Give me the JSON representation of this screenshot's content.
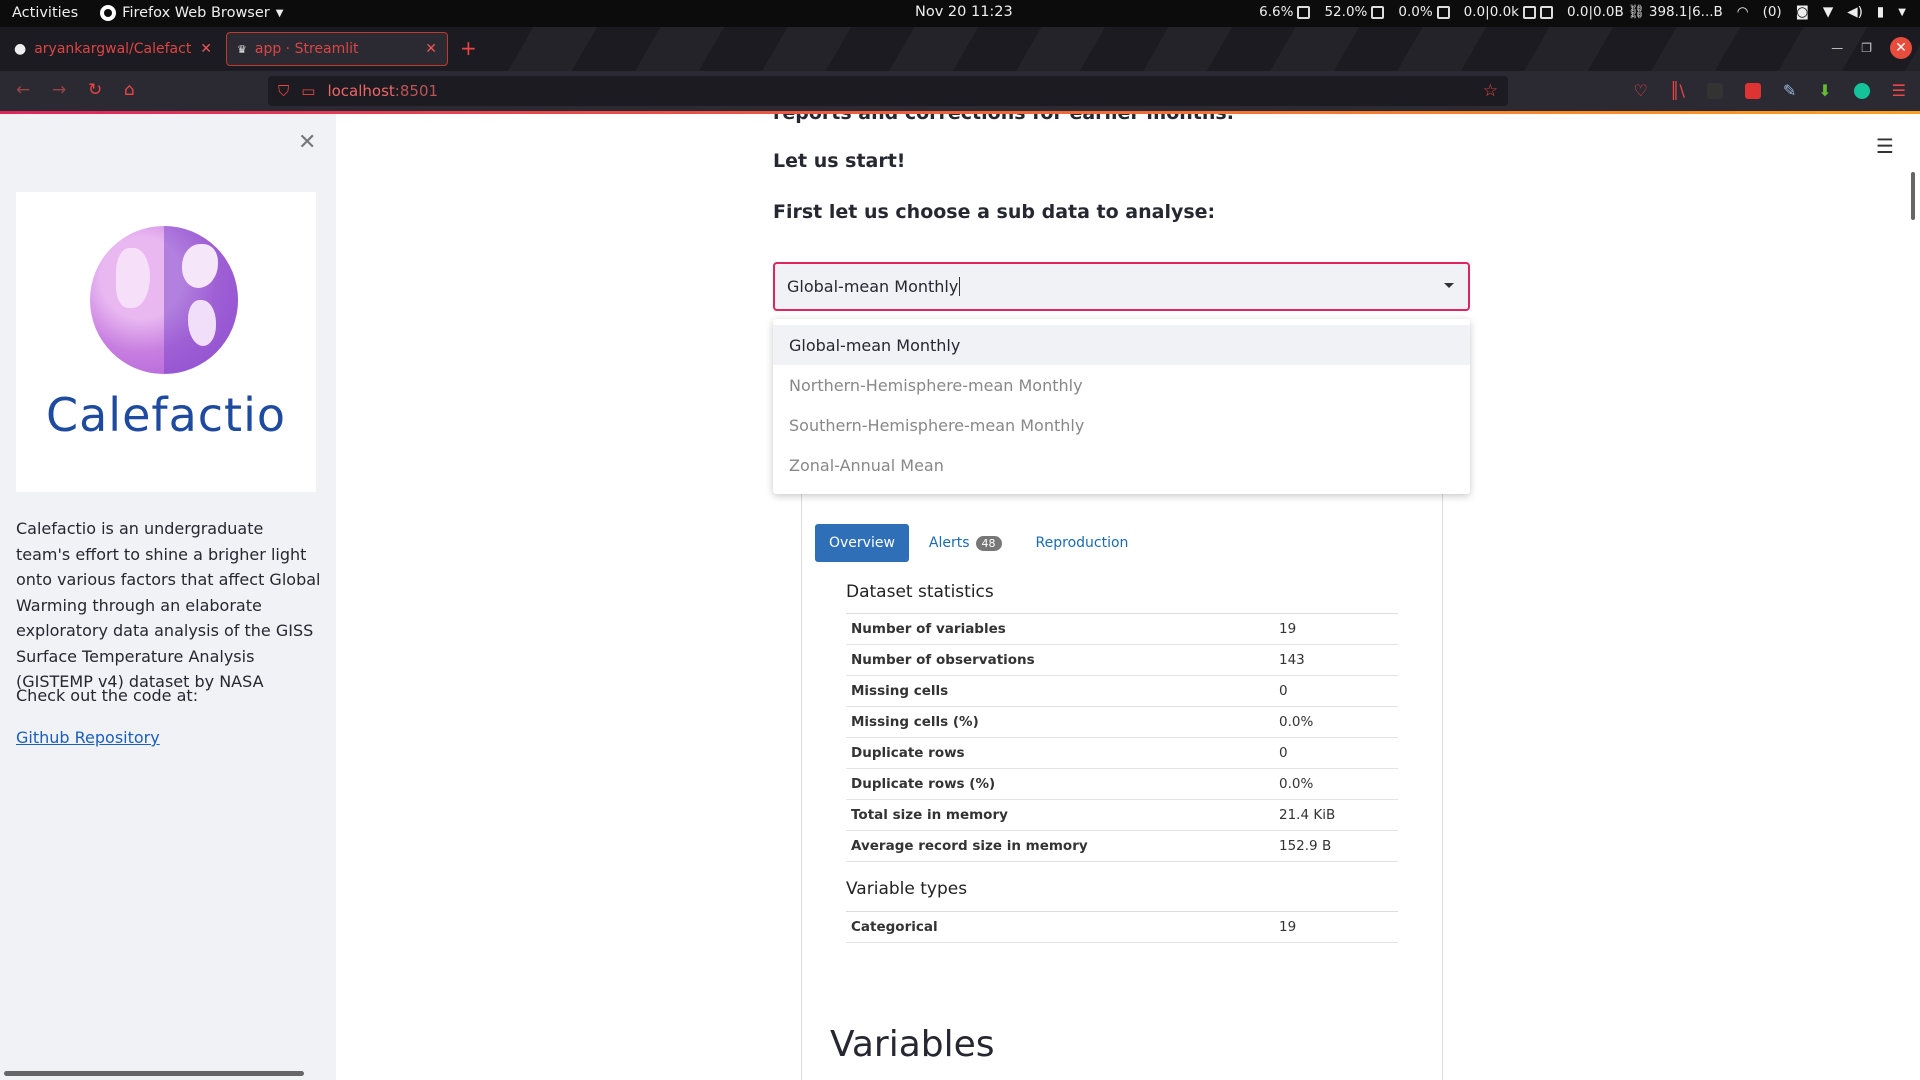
{
  "topbar": {
    "activities": "Activities",
    "app_name": "Firefox Web Browser",
    "clock": "Nov 20  11:23",
    "cpu": "6.6%",
    "mem": "52.0%",
    "swap": "0.0%",
    "net1": "0.0|0.0k",
    "net2": "0.0|0.0B",
    "net3": "398.1|6...B",
    "notif": "(0)"
  },
  "browser": {
    "tabs": [
      {
        "title": "aryankargwal/Calefactio"
      },
      {
        "title": "app · Streamlit"
      }
    ],
    "url_host": "localhost",
    "url_port": ":8501",
    "accent": "#e0245e"
  },
  "sidebar": {
    "logo_text": "Calefactio",
    "description": "Calefactio is an undergraduate team's effort to shine a brigher light onto various factors that affect Global Warming through an elaborate exploratory data analysis of the GISS Surface Temperature Analysis (GISTEMP v4) dataset by NASA",
    "code_label": "Check out the code at:",
    "repo_link": "Github Repository"
  },
  "main": {
    "cut_line": "reports and corrections for earlier months.",
    "lets_start": "Let us start!",
    "choose_prompt": "First let us choose a sub data to analyse:",
    "select_value": "Global-mean Monthly",
    "options": [
      "Global-mean Monthly",
      "Northern-Hemisphere-mean Monthly",
      "Southern-Hemisphere-mean Monthly",
      "Zonal-Annual Mean"
    ]
  },
  "report": {
    "tabs": [
      {
        "label": "Overview"
      },
      {
        "label": "Alerts",
        "badge": "48"
      },
      {
        "label": "Reproduction"
      }
    ],
    "dataset_stats_title": "Dataset statistics",
    "stats": [
      {
        "k": "Number of variables",
        "v": "19"
      },
      {
        "k": "Number of observations",
        "v": "143"
      },
      {
        "k": "Missing cells",
        "v": "0"
      },
      {
        "k": "Missing cells (%)",
        "v": "0.0%"
      },
      {
        "k": "Duplicate rows",
        "v": "0"
      },
      {
        "k": "Duplicate rows (%)",
        "v": "0.0%"
      },
      {
        "k": "Total size in memory",
        "v": "21.4 KiB"
      },
      {
        "k": "Average record size in memory",
        "v": "152.9 B"
      }
    ],
    "var_types_title": "Variable types",
    "var_types": [
      {
        "k": "Categorical",
        "v": "19"
      }
    ],
    "variables_heading": "Variables"
  }
}
